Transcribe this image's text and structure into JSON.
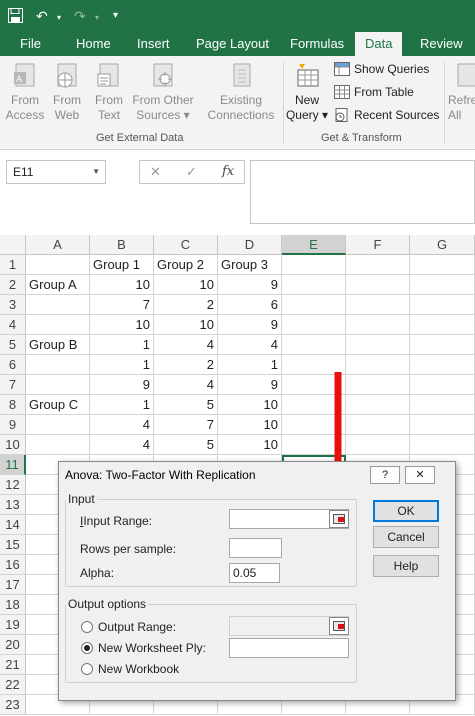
{
  "qat": {
    "save_icon": "save-icon",
    "undo_icon": "undo-icon",
    "redo_icon": "redo-icon",
    "customize_icon": "chevron-down-icon"
  },
  "tabs": [
    "File",
    "Home",
    "Insert",
    "Page Layout",
    "Formulas",
    "Data",
    "Review"
  ],
  "active_tab": "Data",
  "ribbon": {
    "get_external_data": {
      "label": "Get External Data",
      "buttons": [
        {
          "line1": "From",
          "line2": "Access"
        },
        {
          "line1": "From",
          "line2": "Web"
        },
        {
          "line1": "From",
          "line2": "Text"
        },
        {
          "line1": "From Other",
          "line2": "Sources ▾"
        },
        {
          "line1": "Existing",
          "line2": "Connections"
        }
      ]
    },
    "get_transform": {
      "label": "Get & Transform",
      "new_query": {
        "line1": "New",
        "line2": "Query ▾"
      },
      "show_queries": "Show Queries",
      "from_table": "From Table",
      "recent_sources": "Recent Sources"
    },
    "refresh": {
      "line1": "Refre",
      "line2": "All"
    }
  },
  "formula_bar": {
    "name_box": "E11",
    "cancel": "✕",
    "enter": "✓",
    "fx": "fx",
    "value": ""
  },
  "columns": [
    "A",
    "B",
    "C",
    "D",
    "E",
    "F",
    "G"
  ],
  "selected_column": "E",
  "selected_row": 11,
  "rows": [
    {
      "n": "1",
      "a": "",
      "b": "Group 1",
      "c": "Group 2",
      "d": "Group 3"
    },
    {
      "n": "2",
      "a": "Group A",
      "b": "10",
      "c": "10",
      "d": "9"
    },
    {
      "n": "3",
      "a": "",
      "b": "7",
      "c": "2",
      "d": "6"
    },
    {
      "n": "4",
      "a": "",
      "b": "10",
      "c": "10",
      "d": "9"
    },
    {
      "n": "5",
      "a": "Group B",
      "b": "1",
      "c": "4",
      "d": "4"
    },
    {
      "n": "6",
      "a": "",
      "b": "1",
      "c": "2",
      "d": "1"
    },
    {
      "n": "7",
      "a": "",
      "b": "9",
      "c": "4",
      "d": "9"
    },
    {
      "n": "8",
      "a": "Group C",
      "b": "1",
      "c": "5",
      "d": "10"
    },
    {
      "n": "9",
      "a": "",
      "b": "4",
      "c": "7",
      "d": "10"
    },
    {
      "n": "10",
      "a": "",
      "b": "4",
      "c": "5",
      "d": "10"
    },
    {
      "n": "11",
      "a": "",
      "b": "",
      "c": "",
      "d": ""
    },
    {
      "n": "12",
      "a": "",
      "b": "",
      "c": "",
      "d": ""
    },
    {
      "n": "13",
      "a": "",
      "b": "",
      "c": "",
      "d": ""
    },
    {
      "n": "14",
      "a": "",
      "b": "",
      "c": "",
      "d": ""
    },
    {
      "n": "15",
      "a": "",
      "b": "",
      "c": "",
      "d": ""
    },
    {
      "n": "16",
      "a": "",
      "b": "",
      "c": "",
      "d": ""
    },
    {
      "n": "17",
      "a": "",
      "b": "",
      "c": "",
      "d": ""
    },
    {
      "n": "18",
      "a": "",
      "b": "",
      "c": "",
      "d": ""
    },
    {
      "n": "19",
      "a": "",
      "b": "",
      "c": "",
      "d": ""
    },
    {
      "n": "20",
      "a": "",
      "b": "",
      "c": "",
      "d": ""
    },
    {
      "n": "21",
      "a": "",
      "b": "",
      "c": "",
      "d": ""
    },
    {
      "n": "22",
      "a": "",
      "b": "",
      "c": "",
      "d": ""
    },
    {
      "n": "23",
      "a": "",
      "b": "",
      "c": "",
      "d": ""
    }
  ],
  "dialog": {
    "title": "Anova: Two-Factor With Replication",
    "help": "?",
    "close": "✕",
    "input_group": "Input",
    "input_range_label": "Input Range:",
    "input_range_value": "",
    "rows_per_sample_label": "Rows per sample:",
    "rows_per_sample_value": "",
    "alpha_label": "Alpha:",
    "alpha_value": "0.05",
    "output_group": "Output options",
    "output_range_label": "Output Range:",
    "output_range_value": "",
    "new_worksheet_label": "New Worksheet Ply:",
    "new_worksheet_value": "",
    "new_workbook_label": "New Workbook",
    "ok": "OK",
    "cancel": "Cancel",
    "help_btn": "Help",
    "selected_output": "new_worksheet"
  },
  "colors": {
    "excel_green": "#217346",
    "arrow_red": "#e8100c",
    "ok_border": "#0078d7"
  }
}
